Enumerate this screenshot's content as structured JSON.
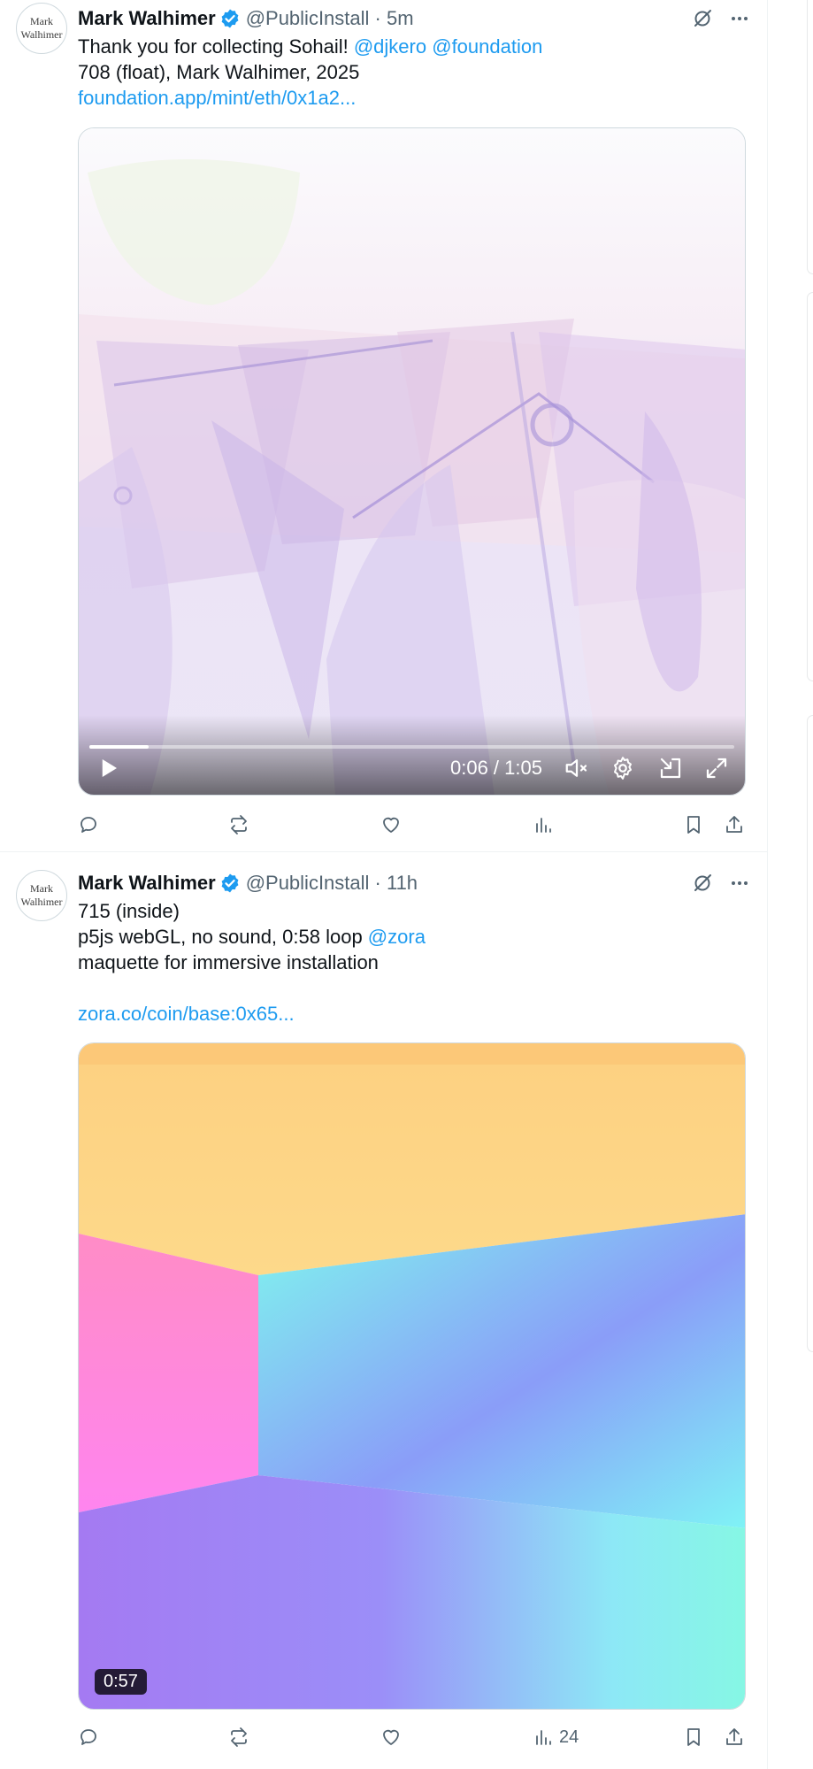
{
  "colors": {
    "link": "#1d9bf0",
    "verified": "#1d9bf0",
    "secondary": "#536471"
  },
  "tweets": [
    {
      "avatar_text": [
        "Mark",
        "Walhimer"
      ],
      "name": "Mark Walhimer",
      "handle": "@PublicInstall · 5m",
      "text_lines": [
        [
          {
            "t": "Thank you for collecting Sohail! "
          },
          {
            "t": "@djkero",
            "link": true
          },
          {
            "t": " "
          },
          {
            "t": "@foundation",
            "link": true
          }
        ],
        [
          {
            "t": "708 (float), Mark Walhimer, 2025"
          }
        ],
        [
          {
            "t": "foundation.app/mint/eth/0x1a2...",
            "link": true
          }
        ]
      ],
      "video": {
        "time": "0:06 / 1:05",
        "progress": 0.0923,
        "state": "paused",
        "muted": true
      },
      "actions": {
        "views": ""
      }
    },
    {
      "avatar_text": [
        "Mark",
        "Walhimer"
      ],
      "name": "Mark Walhimer",
      "handle": "@PublicInstall · 11h",
      "text_lines": [
        [
          {
            "t": "715 (inside)"
          }
        ],
        [
          {
            "t": "p5js webGL, no sound, 0:58 loop "
          },
          {
            "t": "@zora",
            "link": true
          }
        ],
        [
          {
            "t": "maquette for immersive installation"
          }
        ],
        [
          {
            "t": ""
          }
        ],
        [
          {
            "t": "zora.co/coin/base:0x65...",
            "link": true
          }
        ]
      ],
      "video": {
        "duration_badge": "0:57"
      },
      "actions": {
        "views": "24"
      }
    }
  ]
}
